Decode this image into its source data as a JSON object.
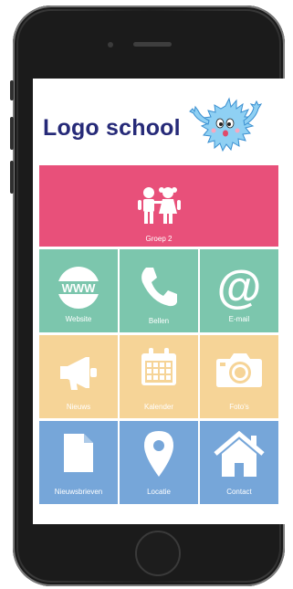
{
  "header": {
    "logo_text": "Logo school"
  },
  "tiles": [
    {
      "label": "Groep 2",
      "icon": "children-icon",
      "color": "#e8507a"
    },
    {
      "label": "Website",
      "icon": "www-icon",
      "color": "#7cc6ad"
    },
    {
      "label": "Bellen",
      "icon": "phone-icon",
      "color": "#7cc6ad"
    },
    {
      "label": "E-mail",
      "icon": "at-sign-icon",
      "color": "#7cc6ad"
    },
    {
      "label": "Nieuws",
      "icon": "megaphone-icon",
      "color": "#f6d497"
    },
    {
      "label": "Kalender",
      "icon": "calendar-icon",
      "color": "#f6d497"
    },
    {
      "label": "Foto's",
      "icon": "camera-icon",
      "color": "#f6d497"
    },
    {
      "label": "Nieuwsbrieven",
      "icon": "document-icon",
      "color": "#76a6d9"
    },
    {
      "label": "Locatie",
      "icon": "location-pin-icon",
      "color": "#76a6d9"
    },
    {
      "label": "Contact",
      "icon": "home-icon",
      "color": "#76a6d9"
    }
  ]
}
